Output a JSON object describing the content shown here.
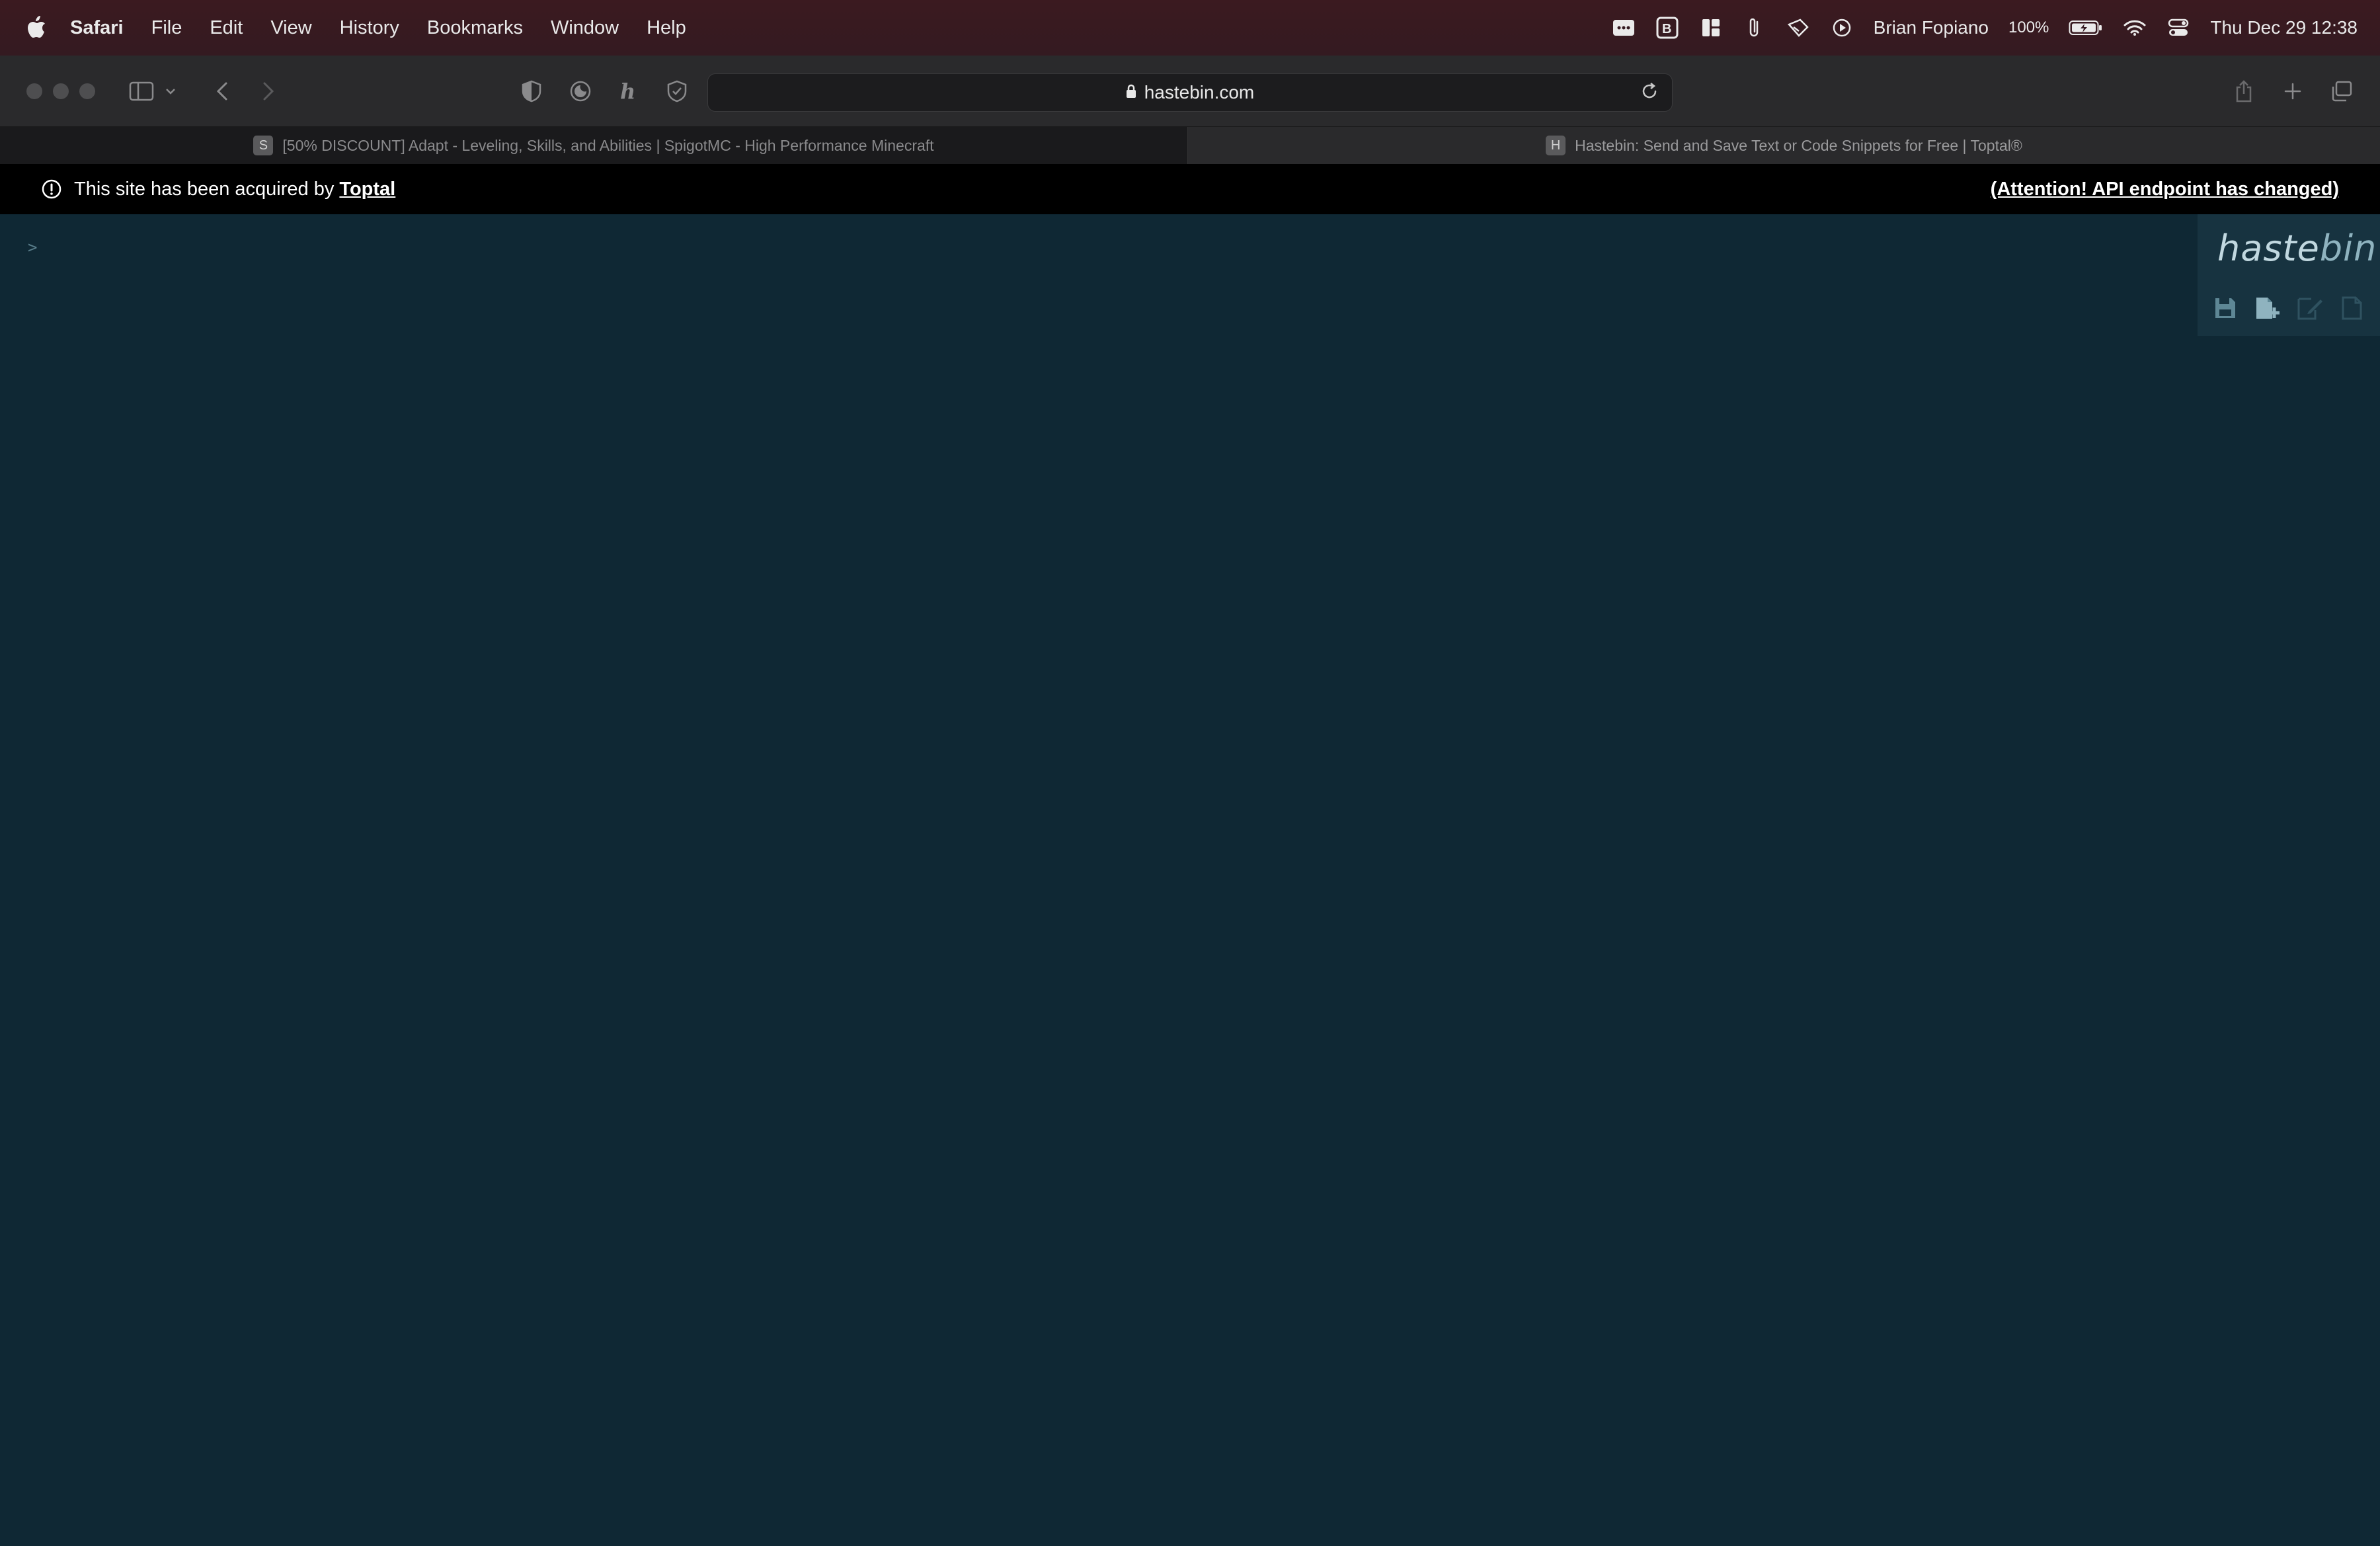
{
  "menubar": {
    "app_name": "Safari",
    "menus": [
      "File",
      "Edit",
      "View",
      "History",
      "Bookmarks",
      "Window",
      "Help"
    ],
    "user": "Brian Fopiano",
    "battery": "100%",
    "datetime": "Thu Dec 29  12:38"
  },
  "browser": {
    "url": "hastebin.com",
    "tabs": [
      {
        "favicon": "S",
        "title": "[50% DISCOUNT] Adapt - Leveling, Skills, and Abilities | SpigotMC - High Performance Minecraft",
        "active": false
      },
      {
        "favicon": "H",
        "title": "Hastebin: Send and Save Text or Code Snippets for Free | Toptal®",
        "active": true
      }
    ]
  },
  "banner": {
    "text": "This site has been acquired by",
    "link": "Toptal",
    "notice": "(Attention! API endpoint has changed)"
  },
  "editor": {
    "prompt": ">",
    "brand_bold": "haste",
    "brand_light": "bin",
    "actions": [
      "save-icon",
      "new-document-icon",
      "duplicate-edit-icon",
      "raw-text-icon"
    ]
  },
  "colors": {
    "editor_bg": "#0f2834",
    "brand_box_bg": "#173340",
    "banner_bg": "#000000"
  }
}
